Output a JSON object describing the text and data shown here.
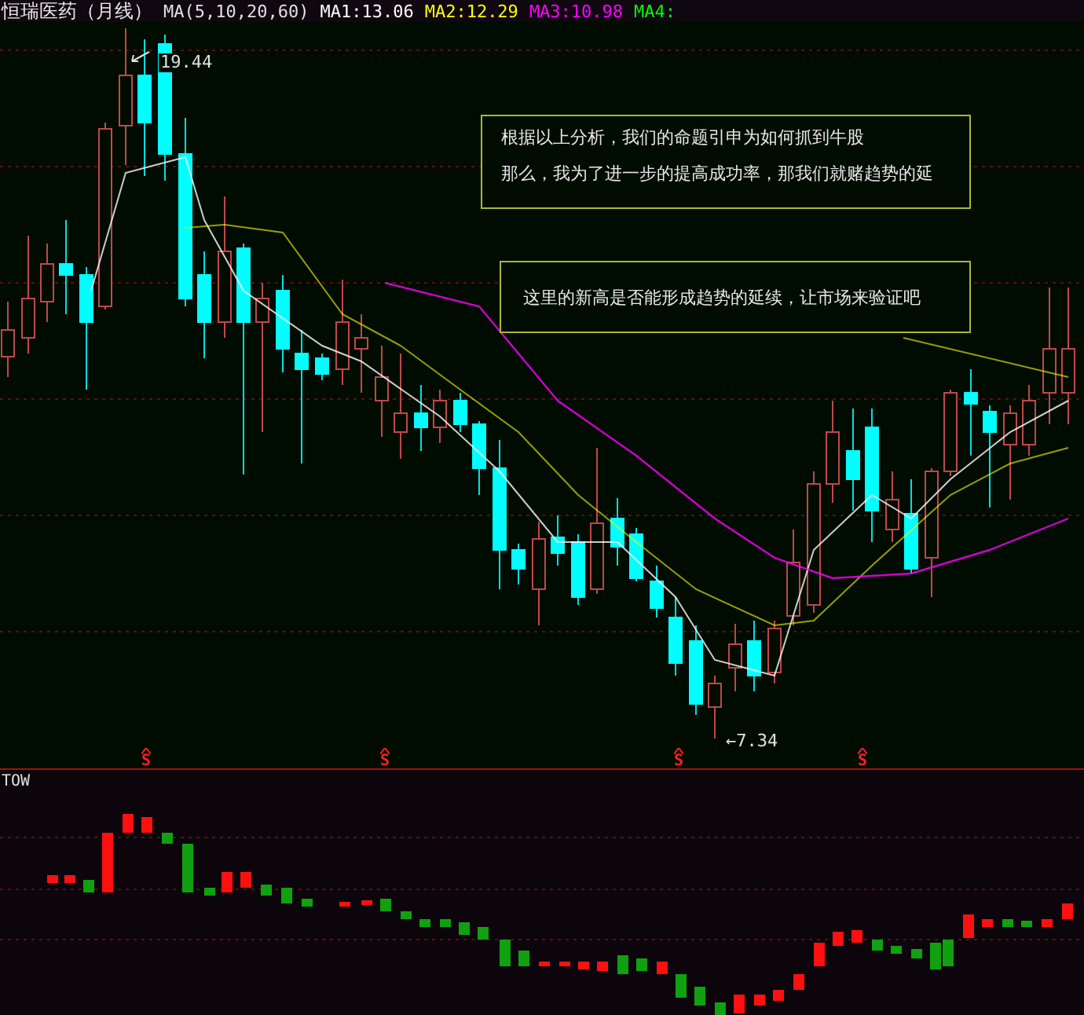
{
  "header": {
    "title": "恒瑞医药（月线）",
    "params": "MA(5,10,20,60)"
  },
  "legend": [
    {
      "label": "MA1:13.06",
      "color": "#ffffff"
    },
    {
      "label": "MA2:12.29",
      "color": "#ffff00"
    },
    {
      "label": "MA3:10.98",
      "color": "#ff00ff"
    },
    {
      "label": "MA4:",
      "color": "#00ff00"
    }
  ],
  "high_label": "19.44",
  "low_label": "←7.34",
  "notes": [
    {
      "lines": [
        "根据以上分析，我们的命题引申为如何抓到牛股",
        "那么，我为了进一步的提高成功率，那我们就赌趋势的延"
      ]
    },
    {
      "lines": [
        "这里的新高是否能形成趋势的延续，让市场来验证吧"
      ]
    }
  ],
  "signals": [
    "S",
    "S",
    "S",
    "S"
  ],
  "indicator": {
    "label": "TOW"
  }
}
